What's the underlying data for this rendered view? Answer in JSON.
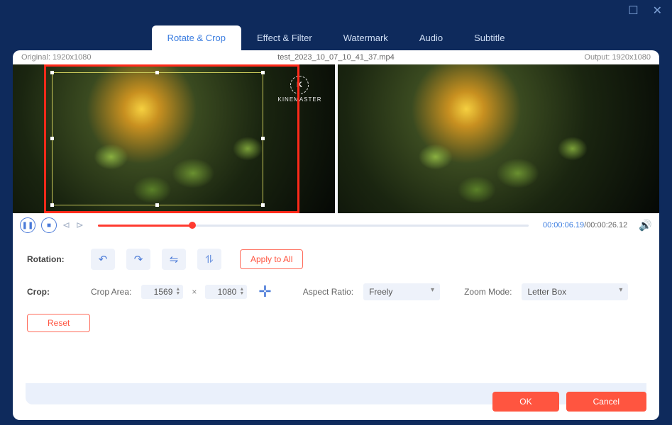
{
  "window": {
    "maximize_glyph": "☐",
    "close_glyph": "✕"
  },
  "tabs": [
    {
      "label": "Rotate & Crop",
      "active": true
    },
    {
      "label": "Effect & Filter",
      "active": false
    },
    {
      "label": "Watermark",
      "active": false
    },
    {
      "label": "Audio",
      "active": false
    },
    {
      "label": "Subtitle",
      "active": false
    }
  ],
  "info": {
    "original_label": "Original:",
    "original_res": "1920x1080",
    "filename": "test_2023_10_07_10_41_37.mp4",
    "output_label": "Output:",
    "output_res": "1920x1080"
  },
  "watermark": {
    "letter": "K",
    "name": "KINEMASTER"
  },
  "playback": {
    "current": "00:00:06.19",
    "sep": "/",
    "total": "00:00:26.12"
  },
  "rotation": {
    "label": "Rotation:",
    "apply_all": "Apply to All",
    "icons": [
      "↶",
      "↷",
      "⇋",
      "⥮"
    ]
  },
  "crop": {
    "label": "Crop:",
    "area_label": "Crop Area:",
    "w": "1569",
    "h": "1080",
    "aspect_label": "Aspect Ratio:",
    "aspect_value": "Freely",
    "zoom_label": "Zoom Mode:",
    "zoom_value": "Letter Box",
    "reset": "Reset"
  },
  "footer": {
    "ok": "OK",
    "cancel": "Cancel"
  }
}
